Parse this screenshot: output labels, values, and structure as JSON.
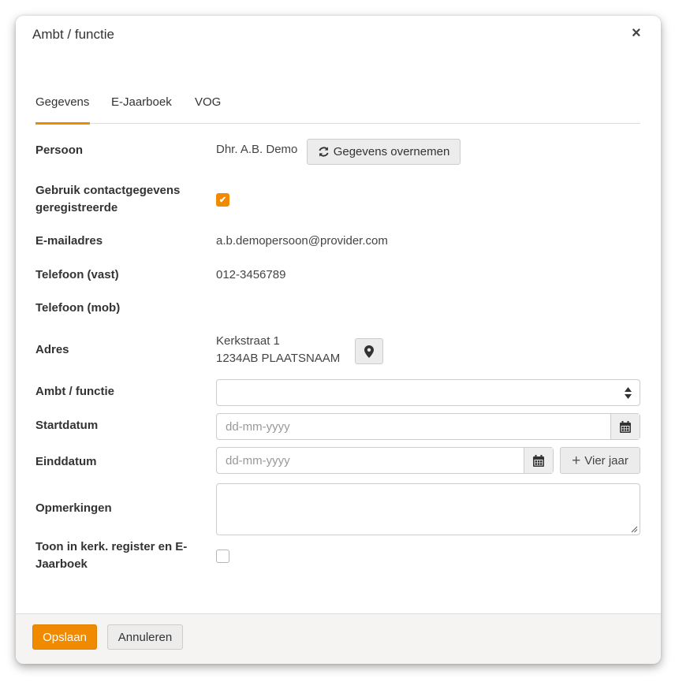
{
  "dialog": {
    "title": "Ambt / functie",
    "close_icon": "×"
  },
  "tabs": [
    {
      "label": "Gegevens",
      "active": true
    },
    {
      "label": "E-Jaarboek",
      "active": false
    },
    {
      "label": "VOG",
      "active": false
    }
  ],
  "form": {
    "persoon": {
      "label": "Persoon",
      "value": "Dhr. A.B. Demo",
      "button_label": "Gegevens overnemen",
      "icon": "refresh-icon"
    },
    "contact": {
      "label_line1": "Gebruik contactgegevens",
      "label_line2": "geregistreerde",
      "checked": true,
      "check_glyph": "✔"
    },
    "email": {
      "label": "E-mailadres",
      "value": "a.b.demopersoon@provider.com"
    },
    "tel_vast": {
      "label": "Telefoon (vast)",
      "value": "012-3456789"
    },
    "tel_mob": {
      "label": "Telefoon (mob)",
      "value": ""
    },
    "adres": {
      "label": "Adres",
      "line1": "Kerkstraat 1",
      "line2": "1234AB PLAATSNAAM",
      "icon": "map-marker-icon"
    },
    "ambt": {
      "label": "Ambt / functie",
      "value": ""
    },
    "startdatum": {
      "label": "Startdatum",
      "placeholder": "dd-mm-yyyy",
      "icon": "calendar-icon"
    },
    "einddatum": {
      "label": "Einddatum",
      "placeholder": "dd-mm-yyyy",
      "icon": "calendar-icon",
      "button_label": "Vier jaar",
      "button_icon": "+"
    },
    "opmerkingen": {
      "label": "Opmerkingen",
      "value": ""
    },
    "toon": {
      "label_line1": "Toon in kerk. register en E-",
      "label_line2": "Jaarboek",
      "checked": false
    }
  },
  "footer": {
    "save_label": "Opslaan",
    "cancel_label": "Annuleren"
  },
  "colors": {
    "accent": "#f08a00",
    "button_grey": "#ececec",
    "footer_bg": "#f5f4f2"
  }
}
